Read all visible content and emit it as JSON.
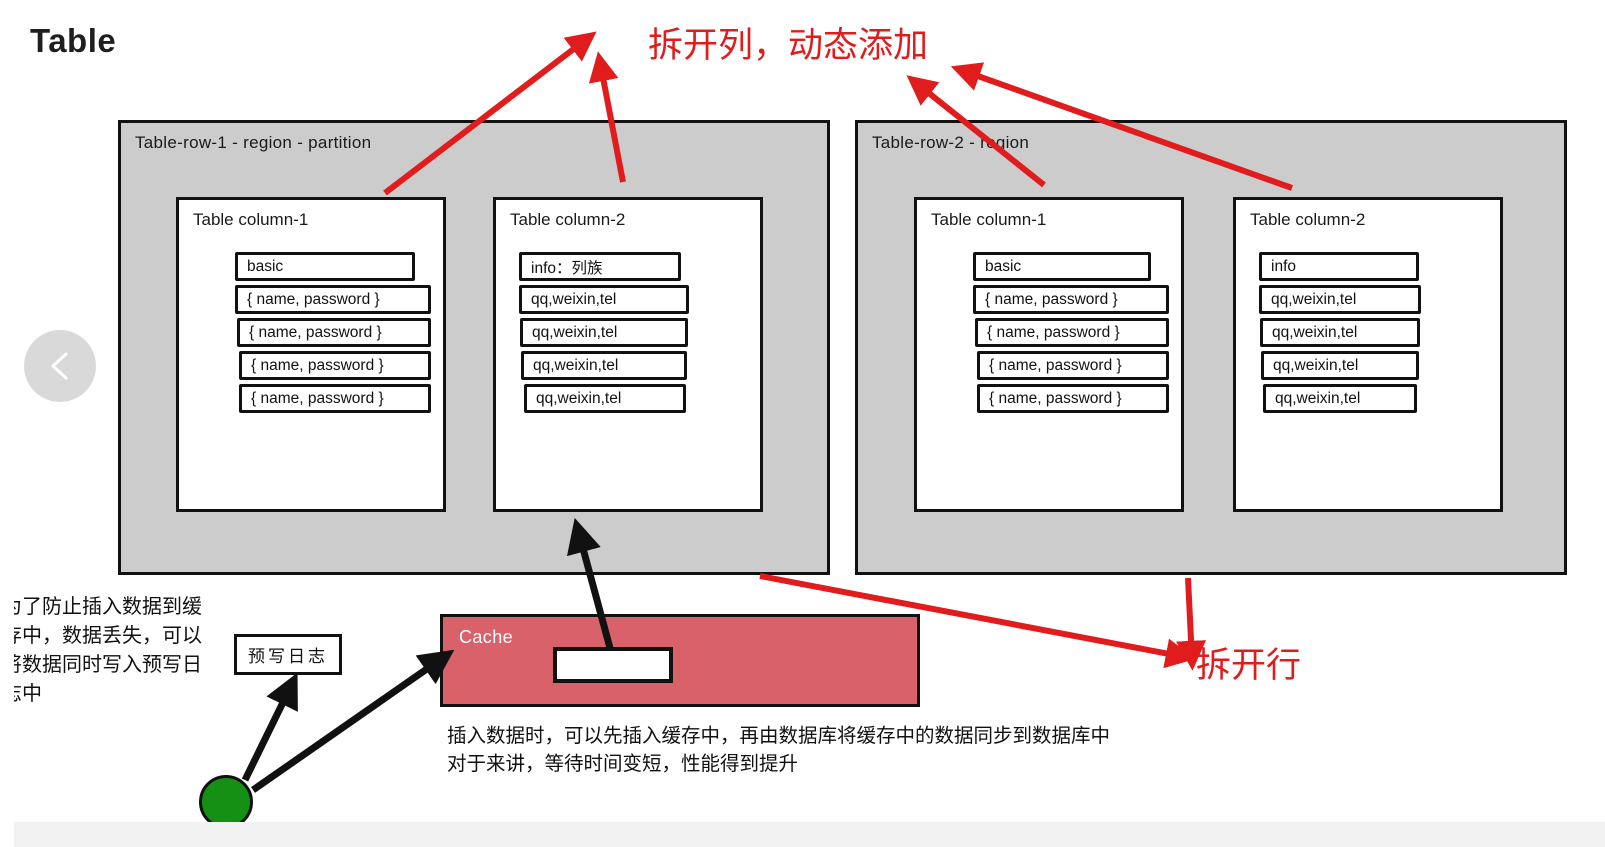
{
  "slide": {
    "title": "Table"
  },
  "nav": {
    "prev_icon": "chevron-left-icon"
  },
  "regions": [
    {
      "id": "region-1",
      "label": "Table-row-1 - region - partition",
      "columns": [
        {
          "label": "Table column-1",
          "cells": [
            "basic",
            "{ name, password }",
            "{ name, password }",
            "{ name, password }",
            "{ name, password }"
          ]
        },
        {
          "label": "Table column-2",
          "cells": [
            "info：列族",
            "qq,weixin,tel",
            "qq,weixin,tel",
            "qq,weixin,tel",
            "qq,weixin,tel"
          ]
        }
      ]
    },
    {
      "id": "region-2",
      "label": "Table-row-2 - region",
      "columns": [
        {
          "label": "Table column-1",
          "cells": [
            "basic",
            "{ name, password }",
            "{ name, password }",
            "{ name, password }",
            "{ name, password }"
          ]
        },
        {
          "label": "Table column-2",
          "cells": [
            "info",
            "qq,weixin,tel",
            "qq,weixin,tel",
            "qq,weixin,tel",
            "qq,weixin,tel"
          ]
        }
      ]
    }
  ],
  "cache": {
    "label": "Cache"
  },
  "wal": {
    "label": "预写日志"
  },
  "notes": {
    "left": "为了防止插入数据到缓存中，数据丢失，可以将数据同时写入预写日志中",
    "bottom_line_1": "插入数据时，可以先插入缓存中，再由数据库将缓存中的数据同步到数据库中",
    "bottom_line_2": "对于来讲，等待时间变短，性能得到提升"
  },
  "annotations": {
    "split_column": "拆开列，动态添加",
    "split_row": "拆开行"
  },
  "colors": {
    "annotation_red": "#e01c1c",
    "cache_fill": "#d9626a",
    "region_fill": "#cccccc",
    "node_green": "#159015",
    "nav_circle": "#d9d9d9"
  }
}
